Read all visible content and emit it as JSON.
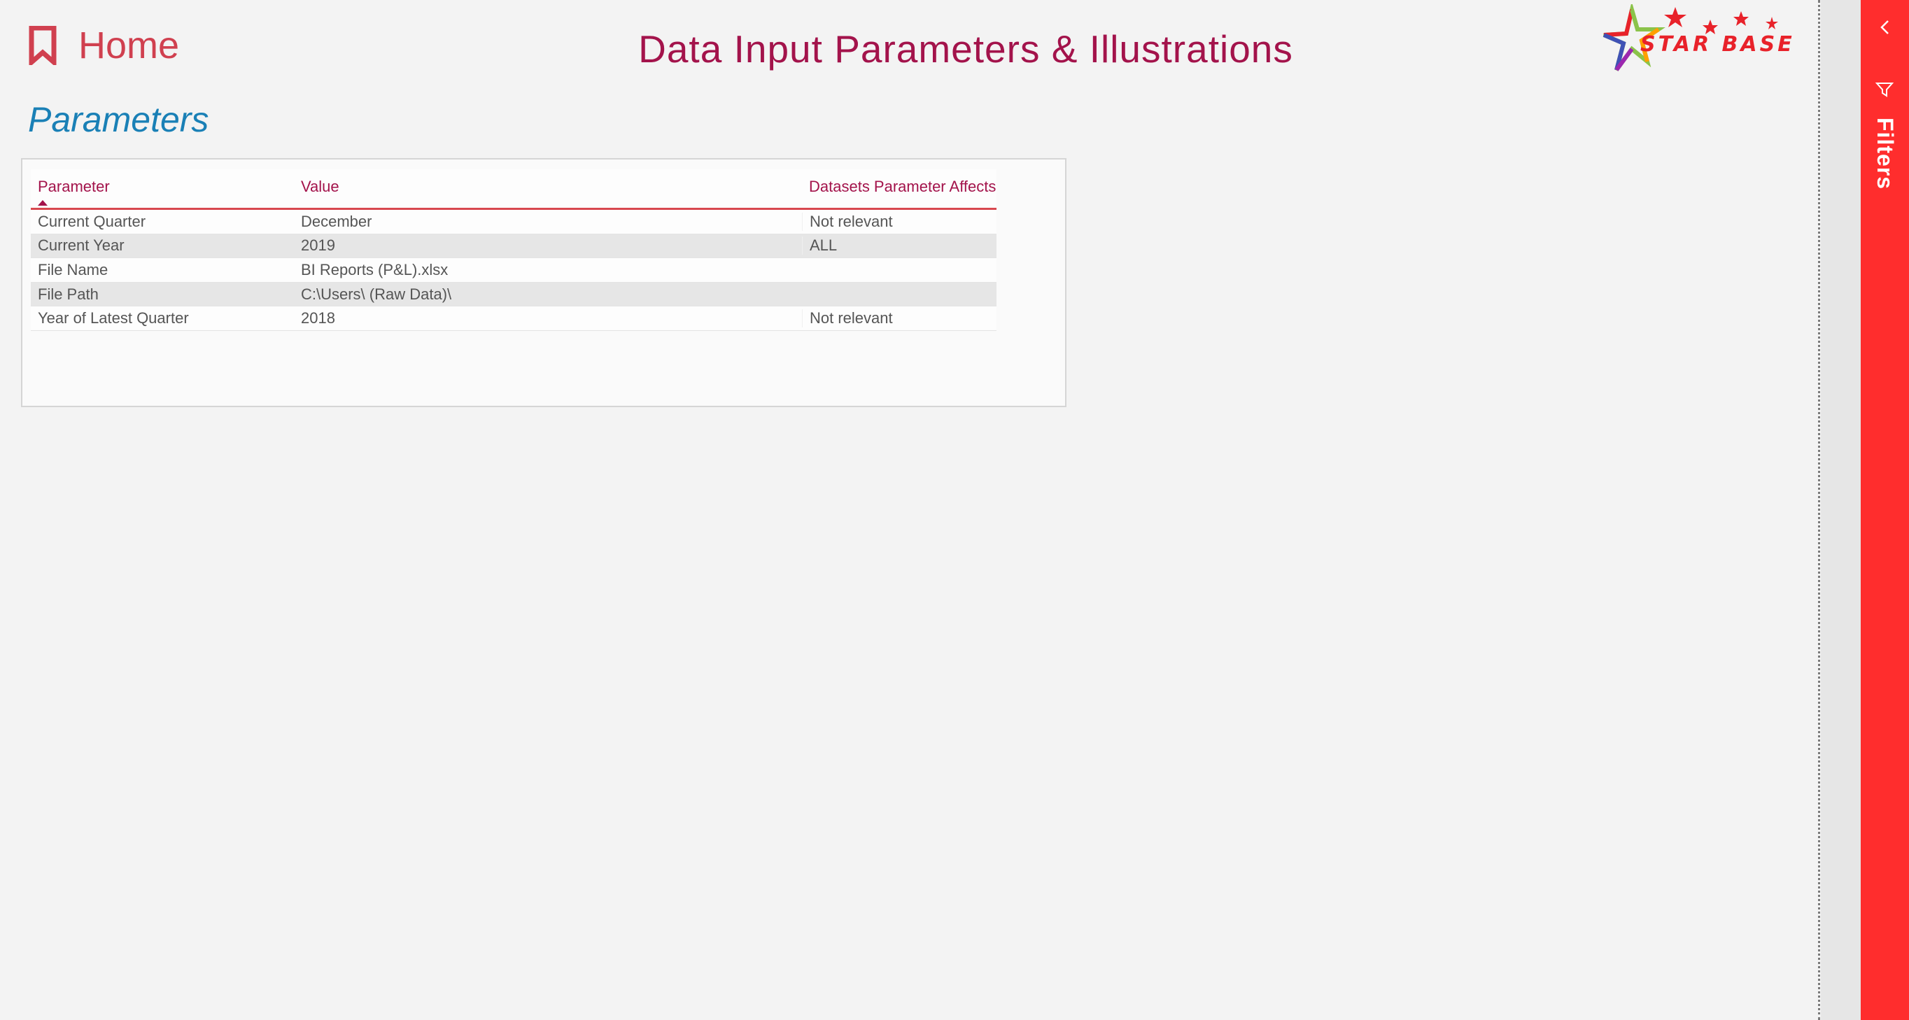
{
  "nav": {
    "home_label": "Home"
  },
  "page": {
    "title": "Data Input Parameters & Illustrations"
  },
  "logo": {
    "text": "STAR BASE"
  },
  "section": {
    "title": "Parameters"
  },
  "table": {
    "columns": [
      "Parameter",
      "Value",
      "Datasets Parameter Affects"
    ],
    "rows": [
      [
        "Current Quarter",
        "December",
        "Not relevant"
      ],
      [
        "Current Year",
        "2019",
        "ALL"
      ],
      [
        "File Name",
        "BI Reports (P&L).xlsx",
        ""
      ],
      [
        "File Path",
        "C:\\Users\\ (Raw Data)\\",
        ""
      ],
      [
        "Year of Latest Quarter",
        "2018",
        "Not relevant"
      ]
    ]
  },
  "filter_pane": {
    "label": "Filters"
  },
  "colors": {
    "accent": "#a3134b",
    "home": "#d0404f",
    "section_title": "#1a80b6",
    "filter_pane": "#ff2d2d"
  },
  "icons": [
    "bookmark-icon",
    "chevron-left-icon",
    "filter-icon",
    "star-logo-icon"
  ]
}
